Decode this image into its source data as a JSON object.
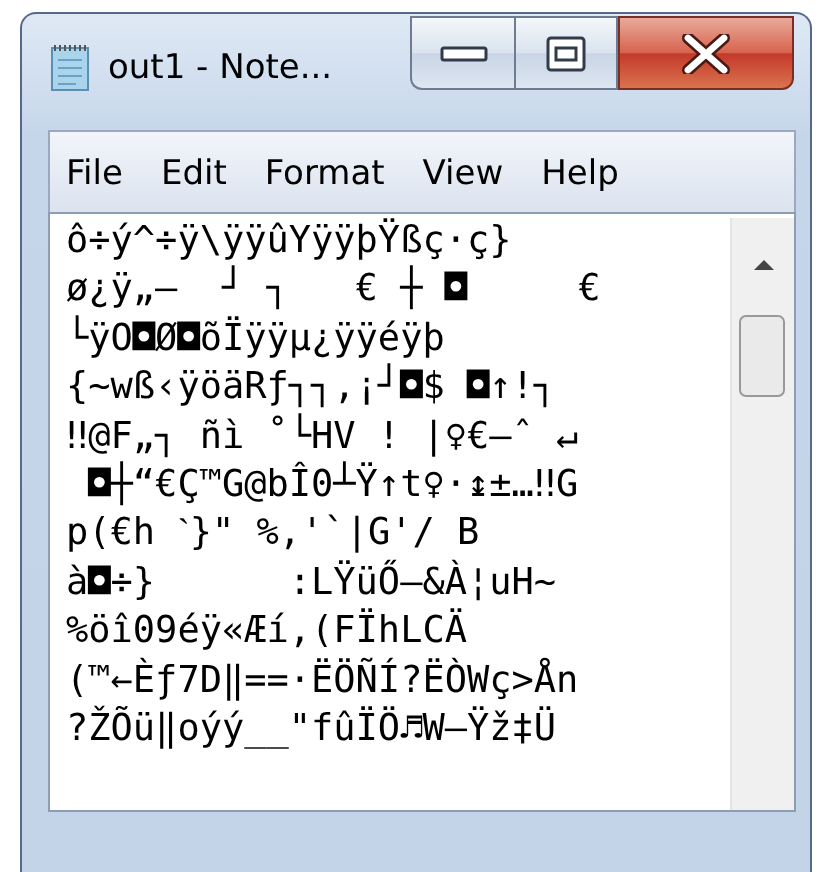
{
  "window": {
    "title": "out1 - Note..."
  },
  "menu": [
    {
      "label": "File"
    },
    {
      "label": "Edit"
    },
    {
      "label": "Format"
    },
    {
      "label": "View"
    },
    {
      "label": "Help"
    }
  ],
  "document": {
    "lines": [
      "ô÷ý^÷ÿ\\ÿÿûYÿÿþŸßç·ç}",
      "ø¿ÿ„–  ┘ ┐   € ┼ ◘     €",
      "└ÿO◘Ø◘õÏÿÿµ¿ÿÿéÿþ",
      "{~wß‹ÿöäRƒ┐┐,¡┘◘$ ◘↑!┐",
      "‼@F„┐ ñì ˚└HV ! |♀€–ˆ ↵",
      " ◘┼“€Ç™G@bÎ0┴Ÿ↑t♀·↨±…‼G",
      "p(€h ˋ}\" %,'`|G'/ B",
      "à◘÷}      :LŸüŐ–&À¦uH~",
      "%öî09éÿ«Æí,(FÏhLCÄ",
      "(™←Èƒ7D‖==·ËÖÑÍ?ËÒWç>Ån",
      "?ŽÕü‖oýý__\"fûÏÖ♬W–Ÿž‡Ü"
    ]
  }
}
